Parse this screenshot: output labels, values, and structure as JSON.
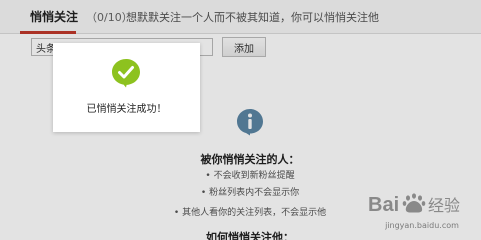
{
  "header": {
    "title": "悄悄关注",
    "count": "（0/10）",
    "description": "想默默关注一个人而不被其知道，你可以悄悄关注他"
  },
  "form": {
    "input_value": "头条新闻",
    "add_label": "添加"
  },
  "info": {
    "heading": "被你悄悄关注的人：",
    "items": [
      "• 不会收到新粉丝提醒",
      "• 粉丝列表内不会显示你",
      "• 其他人看你的关注列表，不会显示他"
    ],
    "howto_heading": "如何悄悄关注他："
  },
  "toast": {
    "message": "已悄悄关注成功！"
  },
  "watermark": {
    "logo_text": "Bai度经验",
    "url": "jingyan.baidu.com"
  },
  "colors": {
    "accent": "#c0392b",
    "success_green": "#8dc21f",
    "info_blue": "#5b86a5"
  }
}
